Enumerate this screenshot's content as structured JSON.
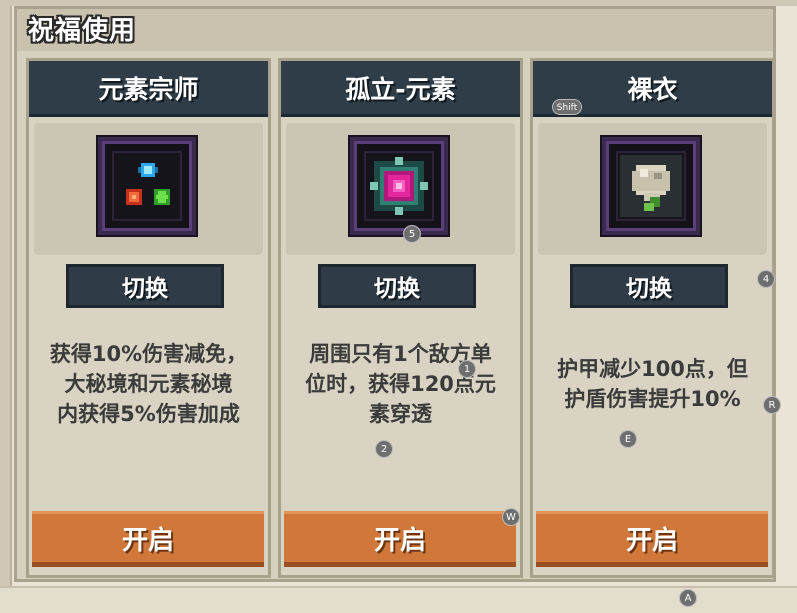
{
  "title": "祝福使用",
  "cards": [
    {
      "name": "元素宗师",
      "icon": "elements-triad-icon",
      "switch_label": "切换",
      "desc_lines": [
        "获得10%伤害减免，",
        "大秘境和元素秘境",
        "内获得5%伤害加成"
      ],
      "open_label": "开启"
    },
    {
      "name": "孤立-元素",
      "icon": "isolated-element-gem-icon",
      "switch_label": "切换",
      "desc_lines": [
        "周围只有1个敌方单",
        "位时，获得120点元",
        "素穿透"
      ],
      "open_label": "开启"
    },
    {
      "name": "裸衣",
      "icon": "bare-armor-icon",
      "switch_label": "切换",
      "desc_lines": [
        "护甲减少100点，但",
        "护盾伤害提升10%"
      ],
      "open_label": "开启"
    }
  ],
  "hotkeys": {
    "shift": "Shift",
    "k5": "5",
    "k4": "4",
    "k1": "1",
    "k2": "2",
    "kR": "R",
    "kE": "E",
    "kW": "W",
    "kA": "A"
  },
  "colors": {
    "header": "#2e3d48",
    "open_button": "#d0783a",
    "panel": "#d9d3c3"
  }
}
